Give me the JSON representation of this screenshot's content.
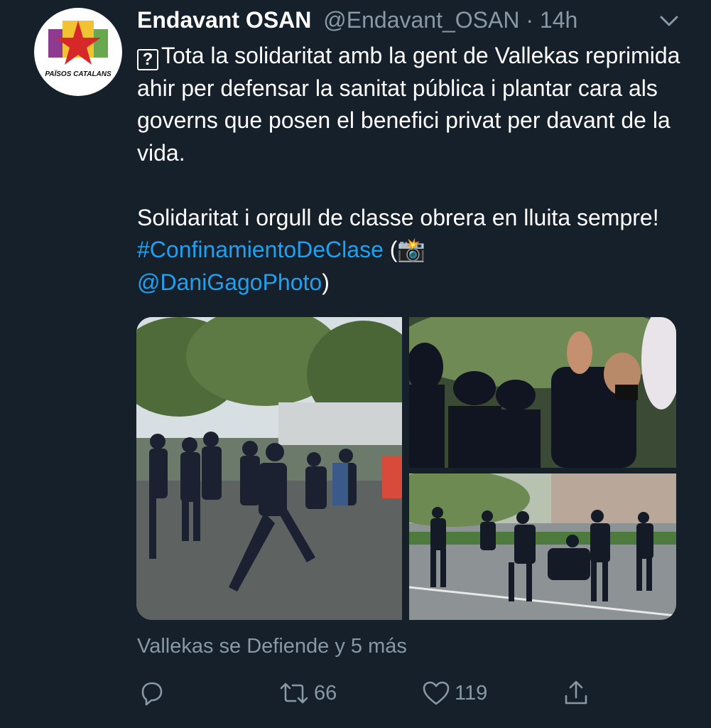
{
  "tweet": {
    "author_name": "Endavant OSAN",
    "author_handle": "@Endavant_OSAN",
    "separator": " · ",
    "time": "14h",
    "avatar_text": "PAÏSOS CATALANS",
    "text": {
      "line1_prefix_glyph": "?",
      "paragraph1": "Tota la solidaritat amb la gent de Vallekas reprimida ahir per defensar la sanitat pública i plantar cara als governs que posen el benefici privat per davant de la vida.",
      "paragraph2_text": "Solidaritat i orgull de classe obrera en lluita sempre! ",
      "hashtag": "#ConfinamientoDeClase",
      "paren_open": " (",
      "camera_emoji": "📸",
      "mention": "@DaniGagoPhoto",
      "paren_close": ")"
    },
    "footer_tag": "Vallekas se Defiende y 5 más",
    "actions": {
      "reply_count": "",
      "retweet_count": "66",
      "like_count": "119"
    }
  },
  "colors": {
    "background": "#15202b",
    "text_primary": "#ffffff",
    "text_secondary": "#8899a6",
    "link": "#1da1f2"
  },
  "icons": [
    "chevron-down-icon",
    "reply-icon",
    "retweet-icon",
    "like-icon",
    "share-icon"
  ]
}
